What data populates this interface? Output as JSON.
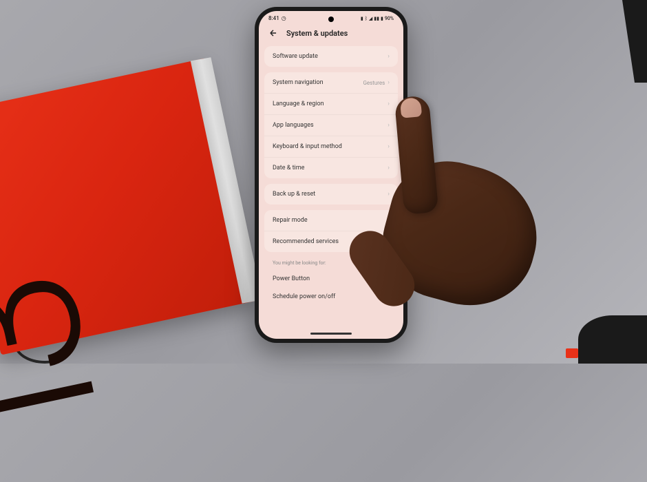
{
  "status": {
    "time": "8:41",
    "battery": "90%"
  },
  "header": {
    "title": "System & updates"
  },
  "groups": [
    {
      "items": [
        {
          "name": "software-update",
          "label": "Software update",
          "value": ""
        }
      ]
    },
    {
      "items": [
        {
          "name": "system-navigation",
          "label": "System navigation",
          "value": "Gestures"
        },
        {
          "name": "language-region",
          "label": "Language & region",
          "value": ""
        },
        {
          "name": "app-languages",
          "label": "App languages",
          "value": ""
        },
        {
          "name": "keyboard-input",
          "label": "Keyboard & input method",
          "value": ""
        },
        {
          "name": "date-time",
          "label": "Date & time",
          "value": ""
        }
      ]
    },
    {
      "items": [
        {
          "name": "backup-reset",
          "label": "Back up & reset",
          "value": ""
        }
      ]
    },
    {
      "items": [
        {
          "name": "repair-mode",
          "label": "Repair mode",
          "value": ""
        },
        {
          "name": "recommended-services",
          "label": "Recommended services",
          "value": ""
        }
      ]
    }
  ],
  "footer": {
    "section_label": "You might be looking for:",
    "items": [
      {
        "name": "power-button",
        "label": "Power Button"
      },
      {
        "name": "schedule-power",
        "label": "Schedule power on/off"
      }
    ]
  },
  "box": {
    "number": "13"
  }
}
